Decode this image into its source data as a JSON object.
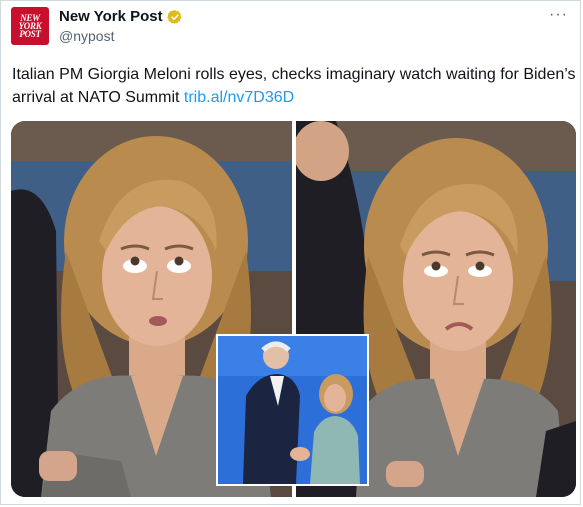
{
  "tweet": {
    "author_name": "New York Post",
    "author_handle": "@nypost",
    "avatar_text": [
      "NEW",
      "YORK",
      "POST"
    ],
    "verified": true,
    "more_label": "···",
    "text": "Italian PM Giorgia Meloni rolls eyes, checks imaginary watch waiting for Biden’s arrival at NATO Summit ",
    "link": "trib.al/nv7D36D"
  },
  "colors": {
    "brand_red": "#c8102e",
    "link_blue": "#1d9bf0",
    "verified_gold": "#e2b719",
    "muted": "#536471"
  },
  "icons": {
    "verified": "verified-badge-icon",
    "more": "more-options-icon"
  }
}
